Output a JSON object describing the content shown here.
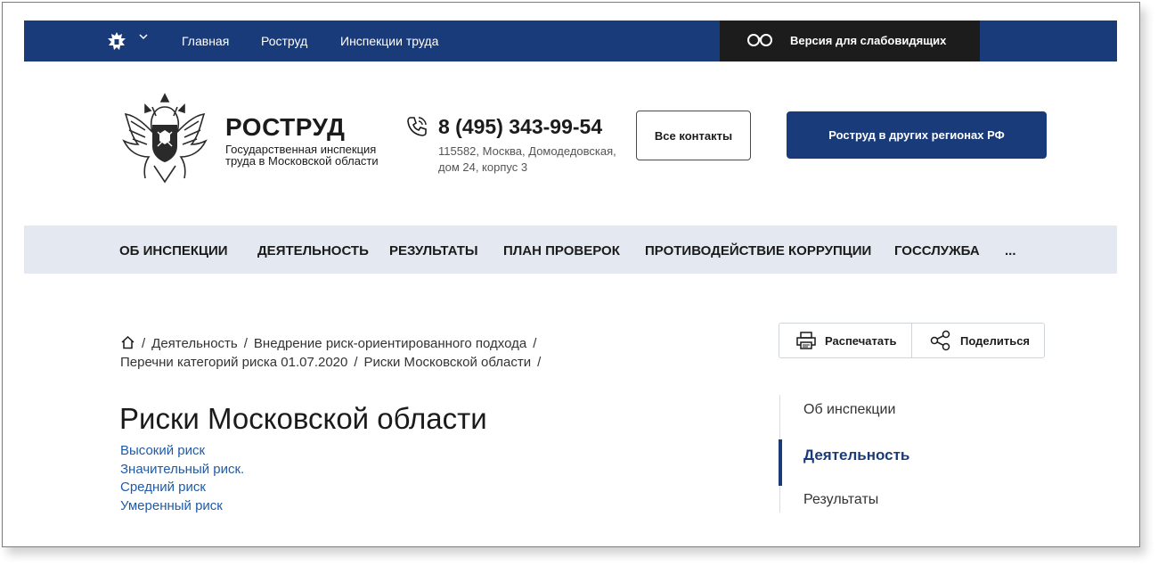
{
  "topbar": {
    "nav": [
      "Главная",
      "Роструд",
      "Инспекции труда"
    ],
    "vision_label": "Версия для слабовидящих"
  },
  "header": {
    "brand_name": "РОСТРУД",
    "brand_sub": "Государственная инспекция труда в Московской области",
    "phone": "8 (495) 343-99-54",
    "address": "115582, Москва, Домодедовская, дом 24, корпус 3",
    "contacts_button": "Все контакты",
    "regions_button": "Роструд в других регионах РФ"
  },
  "menu": [
    "ОБ ИНСПЕКЦИИ",
    "ДЕЯТЕЛЬНОСТЬ",
    "РЕЗУЛЬТАТЫ",
    "ПЛАН ПРОВЕРОК",
    "ПРОТИВОДЕЙСТВИЕ КОРРУПЦИИ",
    "ГОССЛУЖБА",
    "..."
  ],
  "breadcrumb": [
    "Деятельность",
    "Внедрение риск-ориентированного подхода",
    "Перечни категорий риска 01.07.2020",
    "Риски Московской области"
  ],
  "actions": {
    "print": "Распечатать",
    "share": "Поделиться"
  },
  "page": {
    "title": "Риски Московской области",
    "links": [
      "Высокий риск",
      "Значительный риск.",
      "Средний риск",
      "Умеренный риск"
    ]
  },
  "sidenav": {
    "items": [
      "Об инспекции",
      "Деятельность",
      "Результаты"
    ],
    "active": "Деятельность"
  },
  "colors": {
    "brand": "#1a3b7a",
    "link": "#1f5ba8",
    "menu_bg": "#e4e9f1",
    "dark": "#1c1c1c"
  },
  "icons": [
    "emblem-icon",
    "chevron-down-icon",
    "glasses-icon",
    "phone-icon",
    "home-icon",
    "printer-icon",
    "share-icon"
  ]
}
